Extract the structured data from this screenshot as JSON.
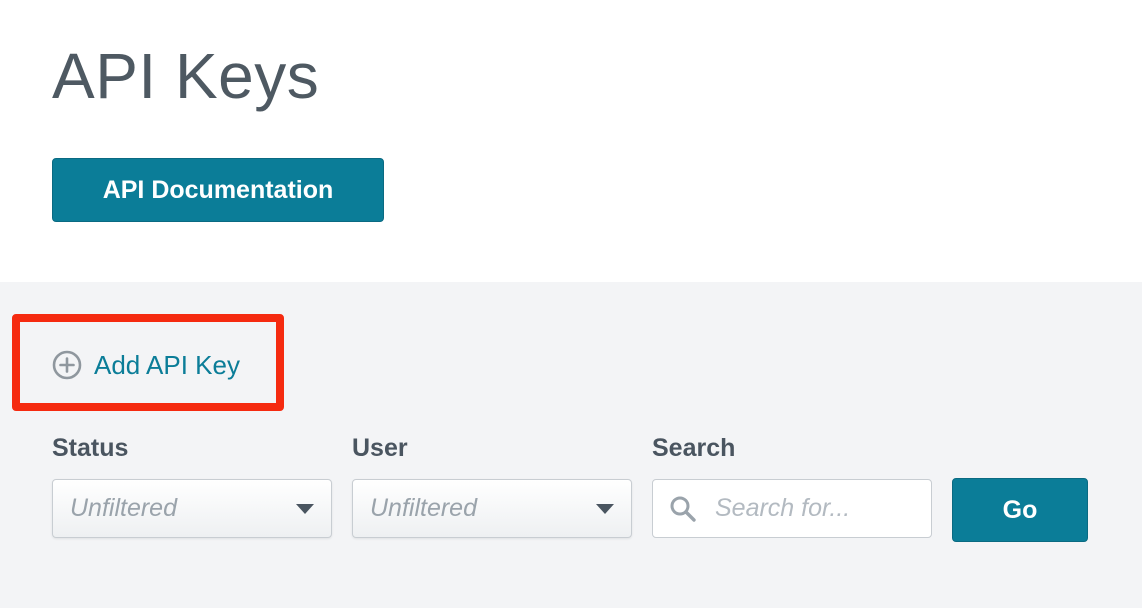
{
  "page": {
    "title": "API Keys"
  },
  "header": {
    "documentation_button_label": "API Documentation"
  },
  "actions": {
    "add_api_key_label": "Add API Key",
    "add_icon": "plus-circle-icon"
  },
  "filters": {
    "status": {
      "label": "Status",
      "value": "Unfiltered"
    },
    "user": {
      "label": "User",
      "value": "Unfiltered"
    },
    "search": {
      "label": "Search",
      "placeholder": "Search for...",
      "value": "",
      "icon": "search-icon"
    },
    "go_label": "Go"
  },
  "colors": {
    "accent": "#0b7d98",
    "highlight": "#f52a10",
    "panel_background": "#f3f4f6",
    "text": "#4a5560"
  }
}
